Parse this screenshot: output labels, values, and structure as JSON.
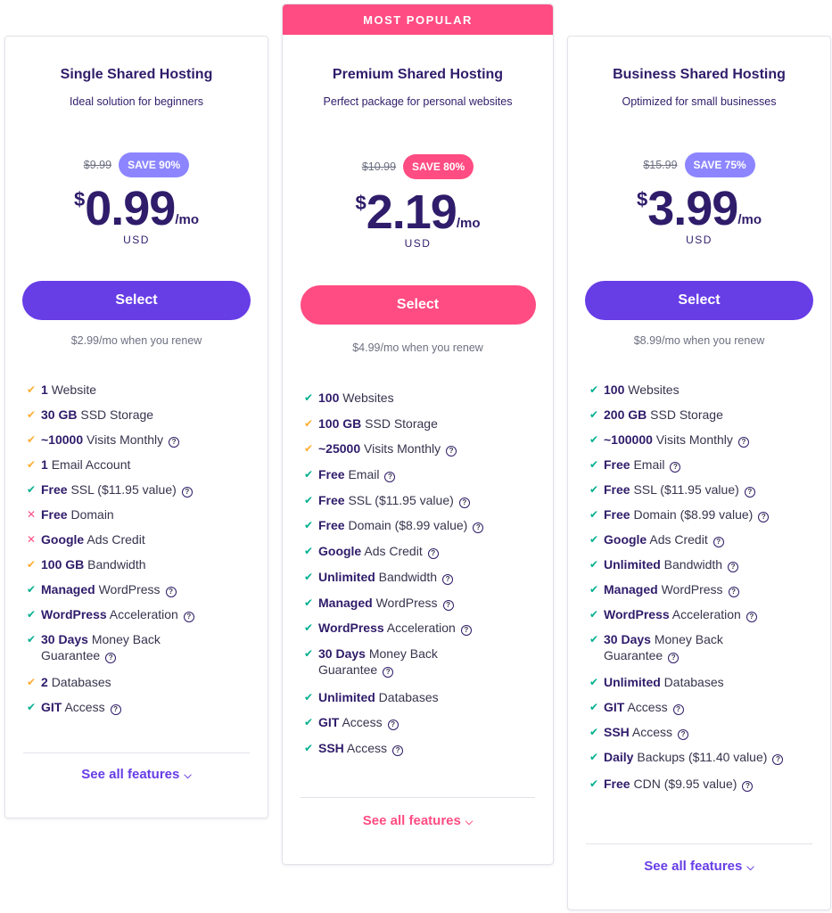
{
  "plans": [
    {
      "title": "Single Shared Hosting",
      "subtitle": "Ideal solution for beginners",
      "old_price": "$9.99",
      "save": "SAVE 90%",
      "currency": "$",
      "amount": "0.99",
      "per": "/mo",
      "usd": "USD",
      "select_label": "Select",
      "renew": "$2.99/mo when you renew",
      "see_all": "See all features",
      "features": [
        {
          "bold": "1",
          "text": "Website",
          "mark": "orange"
        },
        {
          "bold": "30 GB",
          "text": "SSD Storage",
          "mark": "orange"
        },
        {
          "bold": "~10000",
          "text": "Visits Monthly",
          "mark": "orange",
          "help": true
        },
        {
          "bold": "1",
          "text": "Email Account",
          "mark": "orange"
        },
        {
          "bold": "Free",
          "text": "SSL ($11.95 value)",
          "mark": "green",
          "help": true
        },
        {
          "bold": "Free",
          "text": "Domain",
          "mark": "red"
        },
        {
          "bold": "Google",
          "text": "Ads Credit",
          "mark": "red"
        },
        {
          "bold": "100 GB",
          "text": "Bandwidth",
          "mark": "orange"
        },
        {
          "bold": "Managed",
          "text": "WordPress",
          "mark": "green",
          "help": true
        },
        {
          "bold": "WordPress",
          "text": "Acceleration",
          "mark": "green",
          "help": true
        },
        {
          "bold": "30 Days",
          "text": "Money Back Guarantee",
          "mark": "green",
          "help": true
        },
        {
          "bold": "2",
          "text": "Databases",
          "mark": "orange"
        },
        {
          "bold": "GIT",
          "text": "Access",
          "mark": "green",
          "help": true
        }
      ]
    },
    {
      "ribbon": "MOST POPULAR",
      "title": "Premium Shared Hosting",
      "subtitle": "Perfect package for personal websites",
      "old_price": "$10.99",
      "save": "SAVE 80%",
      "currency": "$",
      "amount": "2.19",
      "per": "/mo",
      "usd": "USD",
      "select_label": "Select",
      "renew": "$4.99/mo when you renew",
      "see_all": "See all features",
      "features": [
        {
          "bold": "100",
          "text": "Websites",
          "mark": "green"
        },
        {
          "bold": "100 GB",
          "text": "SSD Storage",
          "mark": "orange"
        },
        {
          "bold": "~25000",
          "text": "Visits Monthly",
          "mark": "orange",
          "help": true
        },
        {
          "bold": "Free",
          "text": "Email",
          "mark": "green",
          "help": true
        },
        {
          "bold": "Free",
          "text": "SSL ($11.95 value)",
          "mark": "green",
          "help": true
        },
        {
          "bold": "Free",
          "text": "Domain ($8.99 value)",
          "mark": "green",
          "help": true
        },
        {
          "bold": "Google",
          "text": "Ads Credit",
          "mark": "green",
          "help": true
        },
        {
          "bold": "Unlimited",
          "text": "Bandwidth",
          "mark": "green",
          "help": true
        },
        {
          "bold": "Managed",
          "text": "WordPress",
          "mark": "green",
          "help": true
        },
        {
          "bold": "WordPress",
          "text": "Acceleration",
          "mark": "green",
          "help": true
        },
        {
          "bold": "30 Days",
          "text": "Money Back Guarantee",
          "mark": "green",
          "help": true
        },
        {
          "bold": "Unlimited",
          "text": "Databases",
          "mark": "green"
        },
        {
          "bold": "GIT",
          "text": "Access",
          "mark": "green",
          "help": true
        },
        {
          "bold": "SSH",
          "text": "Access",
          "mark": "green",
          "help": true
        }
      ]
    },
    {
      "title": "Business Shared Hosting",
      "subtitle": "Optimized for small businesses",
      "old_price": "$15.99",
      "save": "SAVE 75%",
      "currency": "$",
      "amount": "3.99",
      "per": "/mo",
      "usd": "USD",
      "select_label": "Select",
      "renew": "$8.99/mo when you renew",
      "see_all": "See all features",
      "features": [
        {
          "bold": "100",
          "text": "Websites",
          "mark": "green"
        },
        {
          "bold": "200 GB",
          "text": "SSD Storage",
          "mark": "green"
        },
        {
          "bold": "~100000",
          "text": "Visits Monthly",
          "mark": "green",
          "help": true
        },
        {
          "bold": "Free",
          "text": "Email",
          "mark": "green",
          "help": true
        },
        {
          "bold": "Free",
          "text": "SSL ($11.95 value)",
          "mark": "green",
          "help": true
        },
        {
          "bold": "Free",
          "text": "Domain ($8.99 value)",
          "mark": "green",
          "help": true
        },
        {
          "bold": "Google",
          "text": "Ads Credit",
          "mark": "green",
          "help": true
        },
        {
          "bold": "Unlimited",
          "text": "Bandwidth",
          "mark": "green",
          "help": true
        },
        {
          "bold": "Managed",
          "text": "WordPress",
          "mark": "green",
          "help": true
        },
        {
          "bold": "WordPress",
          "text": "Acceleration",
          "mark": "green",
          "help": true
        },
        {
          "bold": "30 Days",
          "text": "Money Back Guarantee",
          "mark": "green",
          "help": true
        },
        {
          "bold": "Unlimited",
          "text": "Databases",
          "mark": "green"
        },
        {
          "bold": "GIT",
          "text": "Access",
          "mark": "green",
          "help": true
        },
        {
          "bold": "SSH",
          "text": "Access",
          "mark": "green",
          "help": true
        },
        {
          "bold": "Daily",
          "text": "Backups ($11.40 value)",
          "mark": "green",
          "help": true
        },
        {
          "bold": "Free",
          "text": "CDN ($9.95 value)",
          "mark": "green",
          "help": true
        }
      ]
    }
  ],
  "colors": {
    "brand_purple": "#673de6",
    "brand_pink": "#ff4c82",
    "dark_text": "#2f1c6a",
    "check_green": "#00b090",
    "check_orange": "#ffad33",
    "cross_red": "#fc5185"
  },
  "icons": {
    "check": "check-icon",
    "cross": "cross-icon",
    "help": "question-circle-icon",
    "chevron": "chevron-down-icon"
  }
}
